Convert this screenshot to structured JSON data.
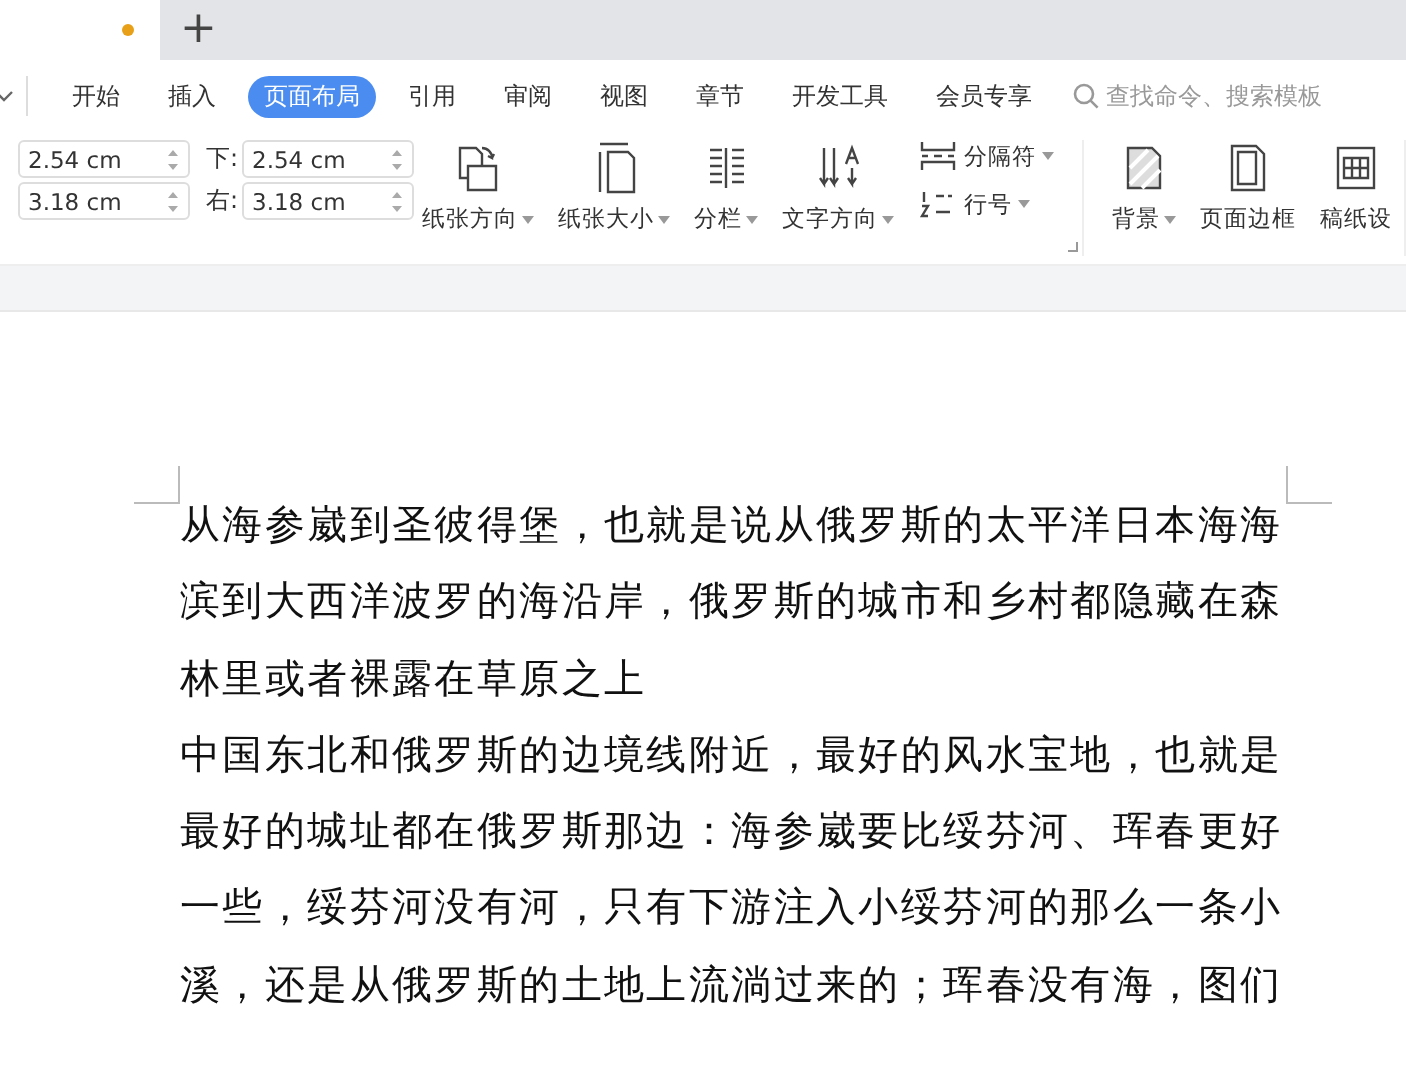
{
  "title_tabs": {
    "new_tab": "+",
    "unsaved": true
  },
  "ribbon_tabs": [
    {
      "label": "开始",
      "selected": false
    },
    {
      "label": "插入",
      "selected": false
    },
    {
      "label": "页面布局",
      "selected": true
    },
    {
      "label": "引用",
      "selected": false
    },
    {
      "label": "审阅",
      "selected": false
    },
    {
      "label": "视图",
      "selected": false
    },
    {
      "label": "章节",
      "selected": false
    },
    {
      "label": "开发工具",
      "selected": false
    },
    {
      "label": "会员专享",
      "selected": false
    }
  ],
  "search": {
    "placeholder": "查找命令、搜索模板"
  },
  "margins": [
    {
      "value": "2.54 cm"
    },
    {
      "label": "下:",
      "value": "2.54 cm"
    },
    {
      "value": "3.18 cm"
    },
    {
      "label": "右:",
      "value": "3.18 cm"
    }
  ],
  "tools": [
    {
      "kind": "orient",
      "label": "纸张方向",
      "dropdown": true
    },
    {
      "kind": "size",
      "label": "纸张大小",
      "dropdown": true
    },
    {
      "kind": "columns",
      "label": "分栏",
      "dropdown": true
    },
    {
      "kind": "direction",
      "label": "文字方向",
      "dropdown": true
    }
  ],
  "small_tools": [
    {
      "kind": "break",
      "label": "分隔符",
      "dropdown": true
    },
    {
      "kind": "lines",
      "label": "行号",
      "dropdown": true
    }
  ],
  "tools2": [
    {
      "kind": "background",
      "label": "背景",
      "dropdown": true
    },
    {
      "kind": "border",
      "label": "页面边框",
      "dropdown": false
    },
    {
      "kind": "grid",
      "label": "稿纸设",
      "dropdown": false
    }
  ],
  "document": {
    "paragraphs": [
      "从海参崴到圣彼得堡，也就是说从俄罗斯的太平洋日本海海滨到大西洋波罗的海沿岸，俄罗斯的城市和乡村都隐藏在森林里或者裸露在草原之上",
      "中国东北和俄罗斯的边境线附近，最好的风水宝地，也就是最好的城址都在俄罗斯那边：海参崴要比绥芬河、珲春更好一些，绥芬河没有河，只有下游注入小绥芬河的那么一条小溪，还是从俄罗斯的土地上流淌过来的；珲春没有海，图们"
    ]
  }
}
